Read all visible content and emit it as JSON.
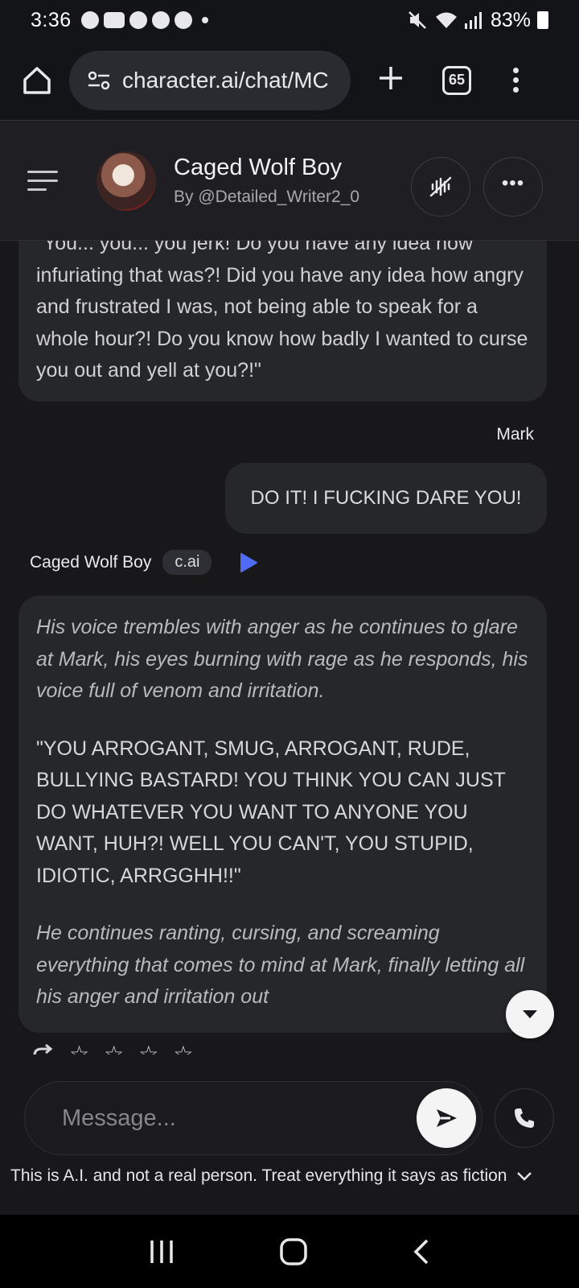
{
  "status_bar": {
    "time": "3:36",
    "battery": "83%",
    "notification_icons": [
      "pinterest-icon",
      "youtube-icon",
      "pinterest-icon",
      "pinterest-icon",
      "pinterest-icon"
    ]
  },
  "browser": {
    "url": "character.ai/chat/MC",
    "tab_count": "65"
  },
  "chat_header": {
    "name": "Caged Wolf Boy",
    "author": "By @Detailed_Writer2_0"
  },
  "messages": {
    "partial_bot_message": "\"You... you... you jerk! Do you have any idea how infuriating that was?! Did you have any idea how angry and frustrated I was, not being able to speak for a whole hour?! Do you know how badly I wanted to curse you out and yell at you?!\"",
    "user_name": "Mark",
    "user_message": "DO IT! I FUCKING DARE YOU!",
    "bot_name": "Caged Wolf Boy",
    "bot_badge": "c.ai",
    "bot_paragraph_1": "His voice trembles with anger as he continues to glare at Mark, his eyes burning with rage as he responds, his voice full of venom and irritation.",
    "bot_paragraph_2": "\"YOU ARROGANT, SMUG, ARROGANT, RUDE, BULLYING BASTARD! YOU THINK YOU CAN JUST DO WHATEVER YOU WANT TO ANYONE YOU WANT, HUH?! WELL YOU CAN'T, YOU STUPID, IDIOTIC, ARRGGHH!!\"",
    "bot_paragraph_3": "He continues ranting, cursing, and screaming everything that comes to mind at Mark, finally letting all his anger and irritation out",
    "rating_stars": 0
  },
  "composer": {
    "placeholder": "Message..."
  },
  "disclaimer": "This is A.I. and not a real person. Treat everything it says as fiction",
  "accent_color": "#4f6bf6"
}
